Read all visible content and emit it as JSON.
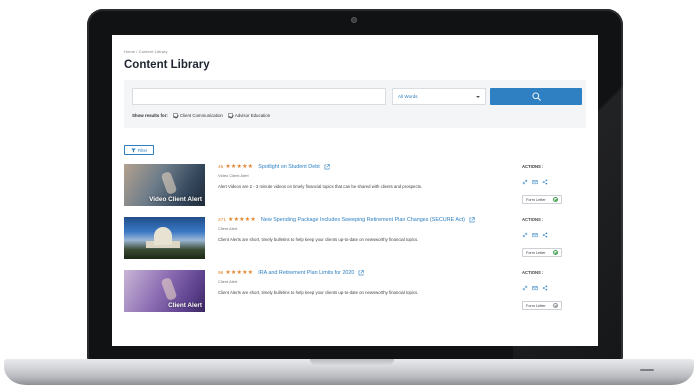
{
  "breadcrumb": "Home / Content Library",
  "page_title": "Content Library",
  "search": {
    "placeholder": "",
    "scope_selected": "All Words",
    "search_icon": "search-icon"
  },
  "show_results": {
    "label": "Show results for:",
    "options": [
      {
        "label": "Client Communication",
        "checked": true
      },
      {
        "label": "Advisor Education",
        "checked": true
      }
    ]
  },
  "filter_label": "Filter",
  "actions_label": "ACTIONS :",
  "form_letter_label": "Form Letter",
  "stars": "★★★★★",
  "results": [
    {
      "count": "46",
      "title": "Spotlight on Student Debt",
      "type": "Video Client Alert",
      "description": "Alert Videos are 2 - 3 minute videos on timely financial topics that can be shared with clients and prospects.",
      "thumb_caption": "Video Client Alert",
      "form_letter_status": "added"
    },
    {
      "count": "271",
      "title": "New Spending Package Includes Sweeping Retirement Plan Changes (SECURE Act)",
      "type": "Client Alert",
      "description": "Client Alerts are short, timely bulletins to help keep your clients up-to-date on newsworthy financial topics.",
      "thumb_caption": "",
      "form_letter_status": "added"
    },
    {
      "count": "96",
      "title": "IRA and Retirement Plan Limits for 2020",
      "type": "Client Alert",
      "description": "Client Alerts are short, timely bulletins to help keep your clients up-to-date on newsworthy financial topics.",
      "thumb_caption": "Client Alert",
      "form_letter_status": "not-added"
    }
  ],
  "colors": {
    "accent": "#2f80c2",
    "star": "#e2842d",
    "success": "#3a9a4a"
  }
}
